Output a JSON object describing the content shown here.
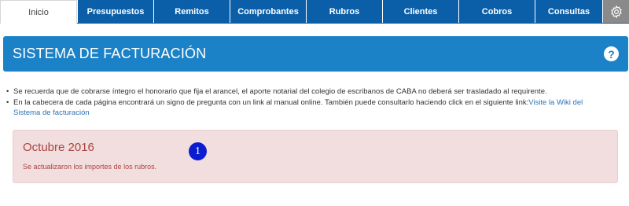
{
  "nav": {
    "tabs": [
      {
        "label": "Inicio",
        "active": true
      },
      {
        "label": "Presupuestos"
      },
      {
        "label": "Remitos"
      },
      {
        "label": "Comprobantes"
      },
      {
        "label": "Rubros"
      },
      {
        "label": "Clientes"
      },
      {
        "label": "Cobros"
      },
      {
        "label": "Consultas"
      }
    ],
    "settings_icon": "gear-icon"
  },
  "header": {
    "title": "SISTEMA DE FACTURACIÓN",
    "help_label": "?"
  },
  "notes": {
    "item1": "Se recuerda que de cobrarse íntegro el honorario que fija el arancel, el aporte notarial del colegio de escribanos de CABA no deberá ser trasladado al requirente.",
    "item2_text": "En la cabecera de cada página encontrará un signo de pregunta con un link al manual online. También puede consultarlo haciendo click en el siguiente link:",
    "item2_link": "Visite la Wiki del Sistema de facturación"
  },
  "alert": {
    "title": "Octubre 2016",
    "message": "Se actualizaron los importes de los rubros."
  },
  "marker": "1",
  "colors": {
    "nav_blue": "#0b5fa8",
    "banner_blue": "#1c82c8",
    "alert_bg": "#f2dede",
    "alert_text": "#a94442",
    "marker": "#0c1cd1"
  }
}
